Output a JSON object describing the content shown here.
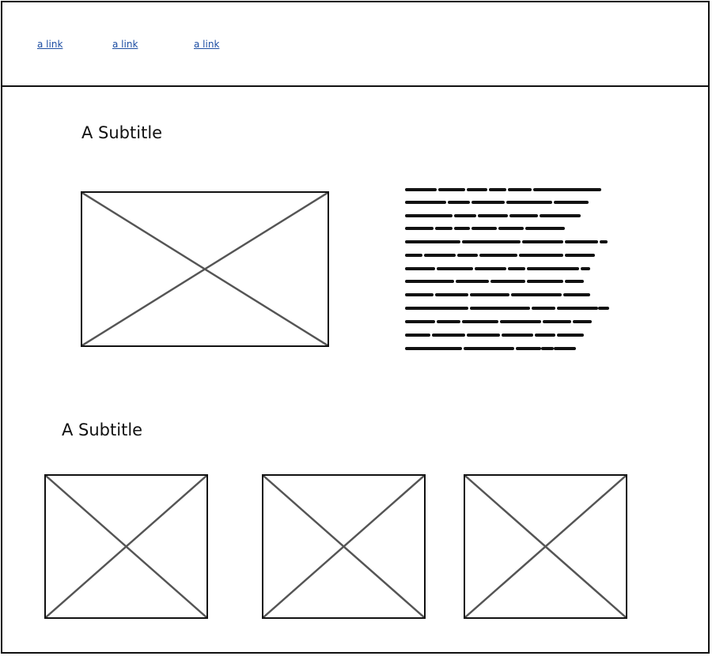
{
  "nav": {
    "links": [
      {
        "label": "a link"
      },
      {
        "label": "a link"
      },
      {
        "label": "a link"
      }
    ]
  },
  "sections": [
    {
      "subtitle": "A Subtitle"
    },
    {
      "subtitle": "A Subtitle"
    }
  ],
  "colors": {
    "link": "#1d4ea3",
    "border": "#111111",
    "placeholder_cross": "#555555"
  },
  "icons": {
    "image_placeholder": "image-placeholder-icon",
    "text_block": "text-placeholder-icon"
  }
}
